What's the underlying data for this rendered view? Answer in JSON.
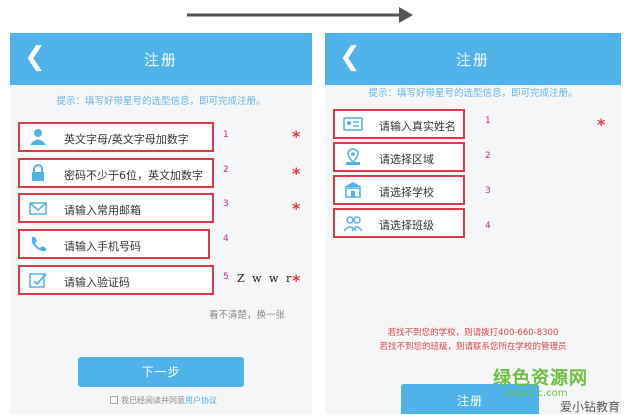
{
  "left_screen": {
    "title": "注册",
    "back_icon": "chevron-left-icon",
    "hint": "提示：填写好带星号的选型信息，即可完成注册。",
    "fields": [
      {
        "icon": "user-icon",
        "placeholder": "英文字母/英文字母加数字",
        "number": "1",
        "required": "*"
      },
      {
        "icon": "lock-icon",
        "placeholder": "密码不少于6位，英文加数字",
        "number": "2",
        "required": "*"
      },
      {
        "icon": "mail-icon",
        "placeholder": "请输入常用邮箱",
        "number": "3",
        "required": "*"
      },
      {
        "icon": "phone-icon",
        "placeholder": "请输入手机号码",
        "number": "4",
        "required": ""
      },
      {
        "icon": "verify-icon",
        "placeholder": "请输入验证码",
        "number": "5",
        "required": "*"
      }
    ],
    "captcha_text": "Z w w r",
    "refresh_text": "看不清楚，换一张",
    "next_button": "下一步",
    "agree_text": "我已经阅读并同意",
    "agree_link": "用户协议"
  },
  "right_screen": {
    "title": "注册",
    "back_icon": "chevron-left-icon",
    "hint": "提示：填写好带星号的选型信息，即可完成注册。",
    "fields": [
      {
        "icon": "id-card-icon",
        "placeholder": "请输入真实姓名",
        "number": "1",
        "required": "*"
      },
      {
        "icon": "location-icon",
        "placeholder": "请选择区域",
        "number": "2",
        "required": ""
      },
      {
        "icon": "school-icon",
        "placeholder": "请选择学校",
        "number": "3",
        "required": ""
      },
      {
        "icon": "group-icon",
        "placeholder": "请选择班级",
        "number": "4",
        "required": ""
      }
    ],
    "notice_line1": "若找不到您的学校，则请拨打400-660-8300",
    "notice_line2": "若找不到您的班级，则请联系您所在学校的管理员",
    "register_button": "注册"
  },
  "watermark": {
    "brand": "绿色资源网",
    "url": "downcc.com",
    "wechat": "爱小钻教育"
  },
  "colors": {
    "accent": "#4fb3ea",
    "highlight_border": "#e03844",
    "required_star": "#e23b3b",
    "number": "#c62b8a"
  }
}
